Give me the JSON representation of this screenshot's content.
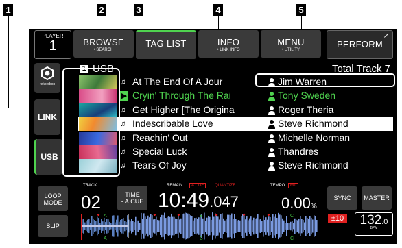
{
  "callouts": [
    "1",
    "2",
    "3",
    "4",
    "5"
  ],
  "player": {
    "label": "PLAYER",
    "number": "1"
  },
  "tabs": [
    {
      "label": "BROWSE",
      "sub": "• SEARCH"
    },
    {
      "label": "TAG LIST",
      "sub": ""
    },
    {
      "label": "INFO",
      "sub": "• LINK INFO"
    },
    {
      "label": "MENU",
      "sub": "• UTILITY"
    },
    {
      "label": "PERFORM",
      "sub": ""
    }
  ],
  "side": {
    "logo": "rekordbox",
    "link": "LINK",
    "usb": "USB"
  },
  "header": {
    "source_num": "1",
    "source": "USB",
    "total": "Total Track 7"
  },
  "tracks": [
    {
      "title": "At The End Of A Jour",
      "artist": "Jim Warren"
    },
    {
      "title": "Cryin' Through The Rai",
      "artist": "Tony Sweden"
    },
    {
      "title": "Get Higher [The Origina",
      "artist": "Roger Theria"
    },
    {
      "title": "Indescribable Love",
      "artist": "Steve Richmond"
    },
    {
      "title": "Reachin' Out",
      "artist": "Michelle Norman"
    },
    {
      "title": "Special Luck",
      "artist": "Thandres"
    },
    {
      "title": "Tears Of Joy",
      "artist": "Steve Richmond"
    }
  ],
  "bottom": {
    "loop_mode": [
      "LOOP",
      "MODE"
    ],
    "slip": "SLIP",
    "track_label": "TRACK",
    "track_num": "02",
    "time": [
      "TIME",
      "- A.CUE"
    ],
    "remain": "REMAIN",
    "acue": "A.CUE",
    "quantize": "QUANTIZE",
    "time_main": "10:49",
    "time_dec": ".047",
    "tempo_label": "TEMPO",
    "mt": "MT",
    "tempo_value": "0.00",
    "tempo_unit": "%",
    "sync": "SYNC",
    "master": "MASTER",
    "range": "±10",
    "bpm_int": "132",
    "bpm_dec": ".0",
    "bpm_unit": "BPM",
    "markers": [
      "A",
      "B",
      "C",
      "A",
      "B",
      "C"
    ]
  },
  "colors": {
    "selected_bg": "#ffffff",
    "loaded_track": "#4fd34f",
    "warning": "#e02020"
  }
}
